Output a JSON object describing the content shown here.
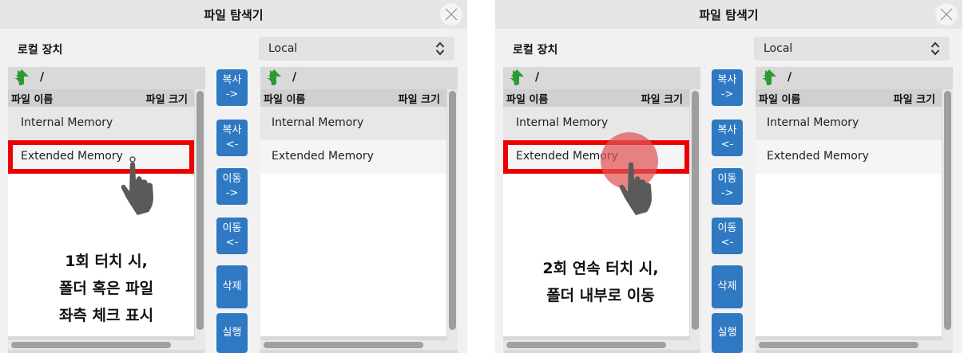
{
  "panels": [
    {
      "window_title": "파일 탐색기",
      "device_label": "로컬 장치",
      "device_select_value": "Local",
      "left_pane": {
        "path": "/",
        "header_name": "파일 이름",
        "header_size": "파일 크기",
        "items": [
          "Internal Memory",
          "Extended Memory"
        ]
      },
      "right_pane": {
        "path": "/",
        "header_name": "파일 이름",
        "header_size": "파일 크기",
        "items": [
          "Internal Memory",
          "Extended Memory"
        ]
      },
      "buttons": [
        "복사 ->",
        "복사 <-",
        "이동 ->",
        "이동 <-",
        "삭제",
        "실행"
      ],
      "caption": [
        "1회 터치 시,",
        "폴더 혹은 파일",
        "좌측 체크 표시"
      ]
    },
    {
      "window_title": "파일 탐색기",
      "device_label": "로컬 장치",
      "device_select_value": "Local",
      "left_pane": {
        "path": "/",
        "header_name": "파일 이름",
        "header_size": "파일 크기",
        "items": [
          "Internal Memory",
          "Extended Memory"
        ]
      },
      "right_pane": {
        "path": "/",
        "header_name": "파일 이름",
        "header_size": "파일 크기",
        "items": [
          "Internal Memory",
          "Extended Memory"
        ]
      },
      "buttons": [
        "복사 ->",
        "복사 <-",
        "이동 ->",
        "이동 <-",
        "삭제",
        "실행"
      ],
      "caption": [
        "2회 연속 터치 시,",
        "폴더 내부로 이동"
      ]
    }
  ],
  "icons": {
    "close": "close-icon",
    "select": "chevron-up-down-icon",
    "up": "up-arrow-icon",
    "pointer": "hand-pointer-icon"
  },
  "colors": {
    "accent_button": "#2f79c3",
    "highlight_box": "#ee0000",
    "up_arrow": "#2e9a33",
    "tap_indicator": "#e25454"
  }
}
